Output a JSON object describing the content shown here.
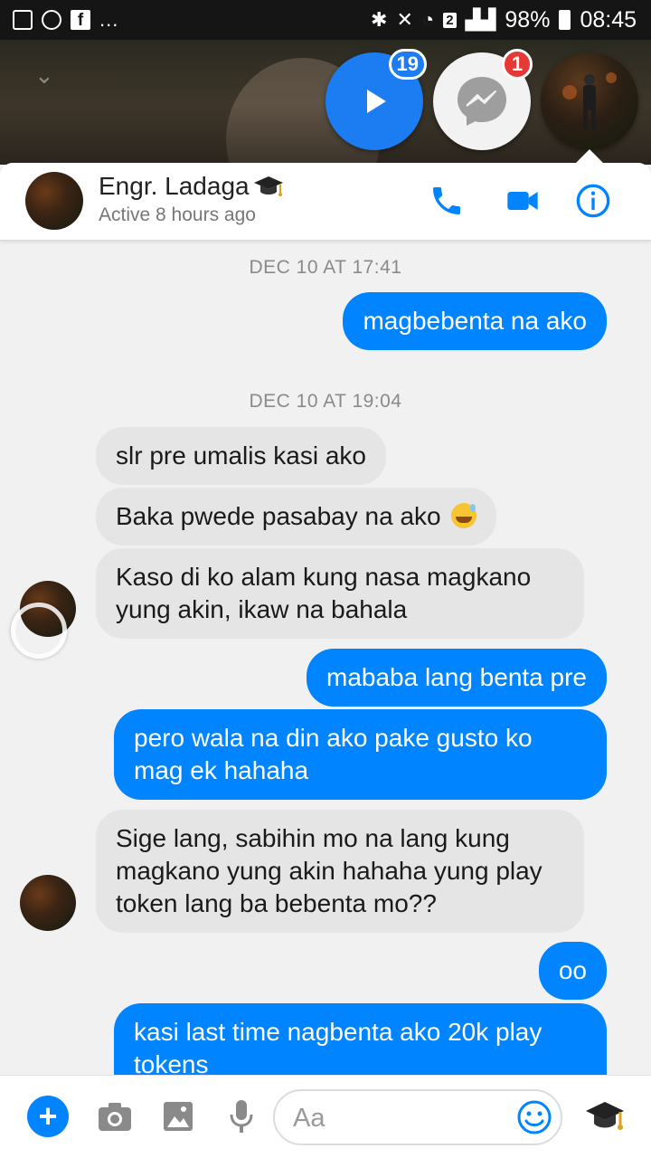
{
  "status_bar": {
    "battery": "98%",
    "time": "08:45",
    "more_dots": "...",
    "sim_label": "2"
  },
  "chat_heads": {
    "video_badge": "19",
    "messenger_badge": "1"
  },
  "header": {
    "name": "Engr. Ladaga",
    "status": "Active 8 hours ago"
  },
  "thread": {
    "timestamps": [
      "DEC 10 AT 17:41",
      "DEC 10 AT 19:04"
    ],
    "messages": [
      {
        "dir": "out",
        "text": "magbebenta na ako"
      },
      {
        "dir": "in",
        "text": "slr pre umalis kasi ako"
      },
      {
        "dir": "in",
        "text": "Baka pwede pasabay na ako",
        "emoji": "sweat-smile"
      },
      {
        "dir": "in",
        "text": "Kaso di ko alam kung nasa magkano yung akin, ikaw na bahala"
      },
      {
        "dir": "out",
        "text": "mababa lang benta pre"
      },
      {
        "dir": "out",
        "text": "pero wala na din ako pake gusto ko mag ek hahaha"
      },
      {
        "dir": "in",
        "text": "Sige lang, sabihin mo na lang kung magkano yung akin hahaha yung play token lang ba bebenta mo??"
      },
      {
        "dir": "out",
        "text": "oo"
      },
      {
        "dir": "out",
        "text": "kasi last time nagbenta ako 20k play tokens"
      }
    ]
  },
  "composer": {
    "placeholder": "Aa"
  },
  "colors": {
    "messenger_blue": "#0084ff",
    "incoming_bubble": "#e5e5e5",
    "badge_red": "#e53935"
  },
  "icons": [
    "gallery-icon",
    "face-icon",
    "facebook-icon",
    "bluetooth-icon",
    "mute-icon",
    "wifi-icon",
    "signal-icon",
    "battery-icon",
    "play-icon",
    "messenger-icon",
    "phone-icon",
    "video-call-icon",
    "info-icon",
    "plus-icon",
    "camera-icon",
    "image-icon",
    "mic-icon",
    "emoji-icon",
    "graduation-cap-icon"
  ]
}
